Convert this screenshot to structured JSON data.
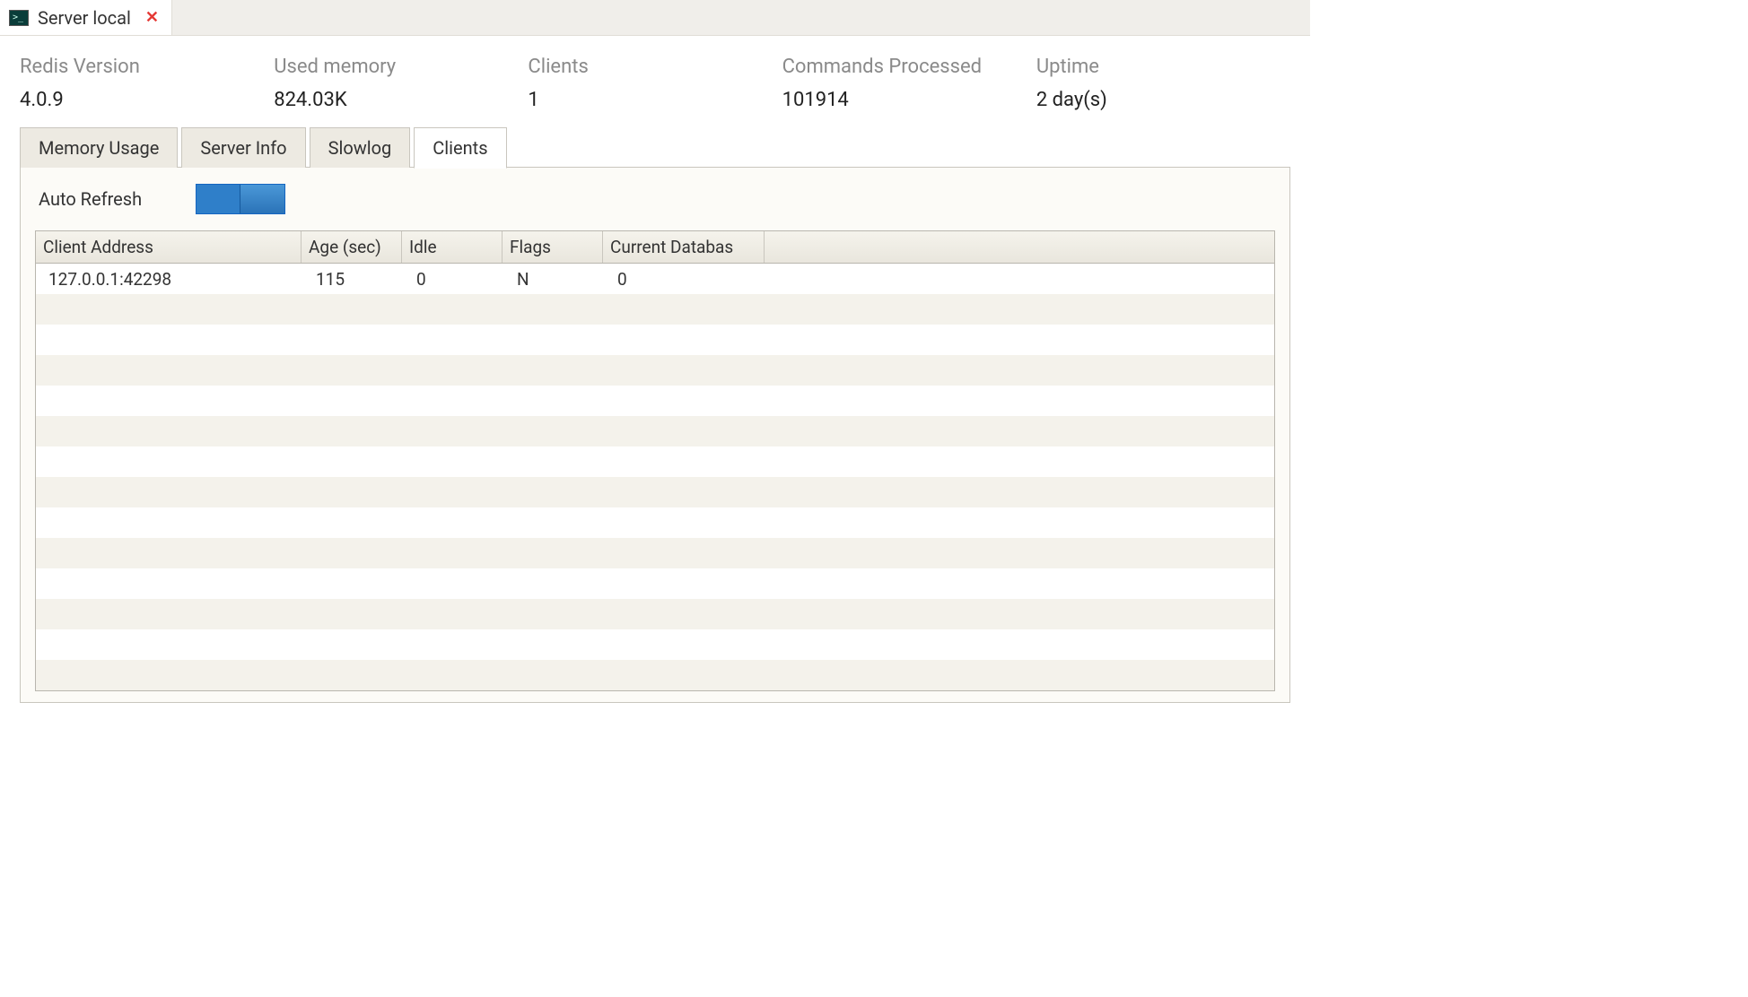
{
  "serverTab": {
    "label": "Server local"
  },
  "stats": {
    "redisVersion": {
      "label": "Redis Version",
      "value": "4.0.9"
    },
    "usedMemory": {
      "label": "Used memory",
      "value": "824.03K"
    },
    "clients": {
      "label": "Clients",
      "value": "1"
    },
    "commands": {
      "label": "Commands Processed",
      "value": "101914"
    },
    "uptime": {
      "label": "Uptime",
      "value": "2 day(s)"
    }
  },
  "subtabs": {
    "memory": "Memory Usage",
    "server": "Server Info",
    "slowlog": "Slowlog",
    "clients": "Clients"
  },
  "autoRefresh": {
    "label": "Auto Refresh",
    "on": true
  },
  "table": {
    "headers": {
      "addr": "Client Address",
      "age": "Age (sec)",
      "idle": "Idle",
      "flags": "Flags",
      "db": "Current Databas"
    },
    "rows": [
      {
        "addr": "127.0.0.1:42298",
        "age": "115",
        "idle": "0",
        "flags": "N",
        "db": "0"
      }
    ],
    "emptyRows": 13
  }
}
